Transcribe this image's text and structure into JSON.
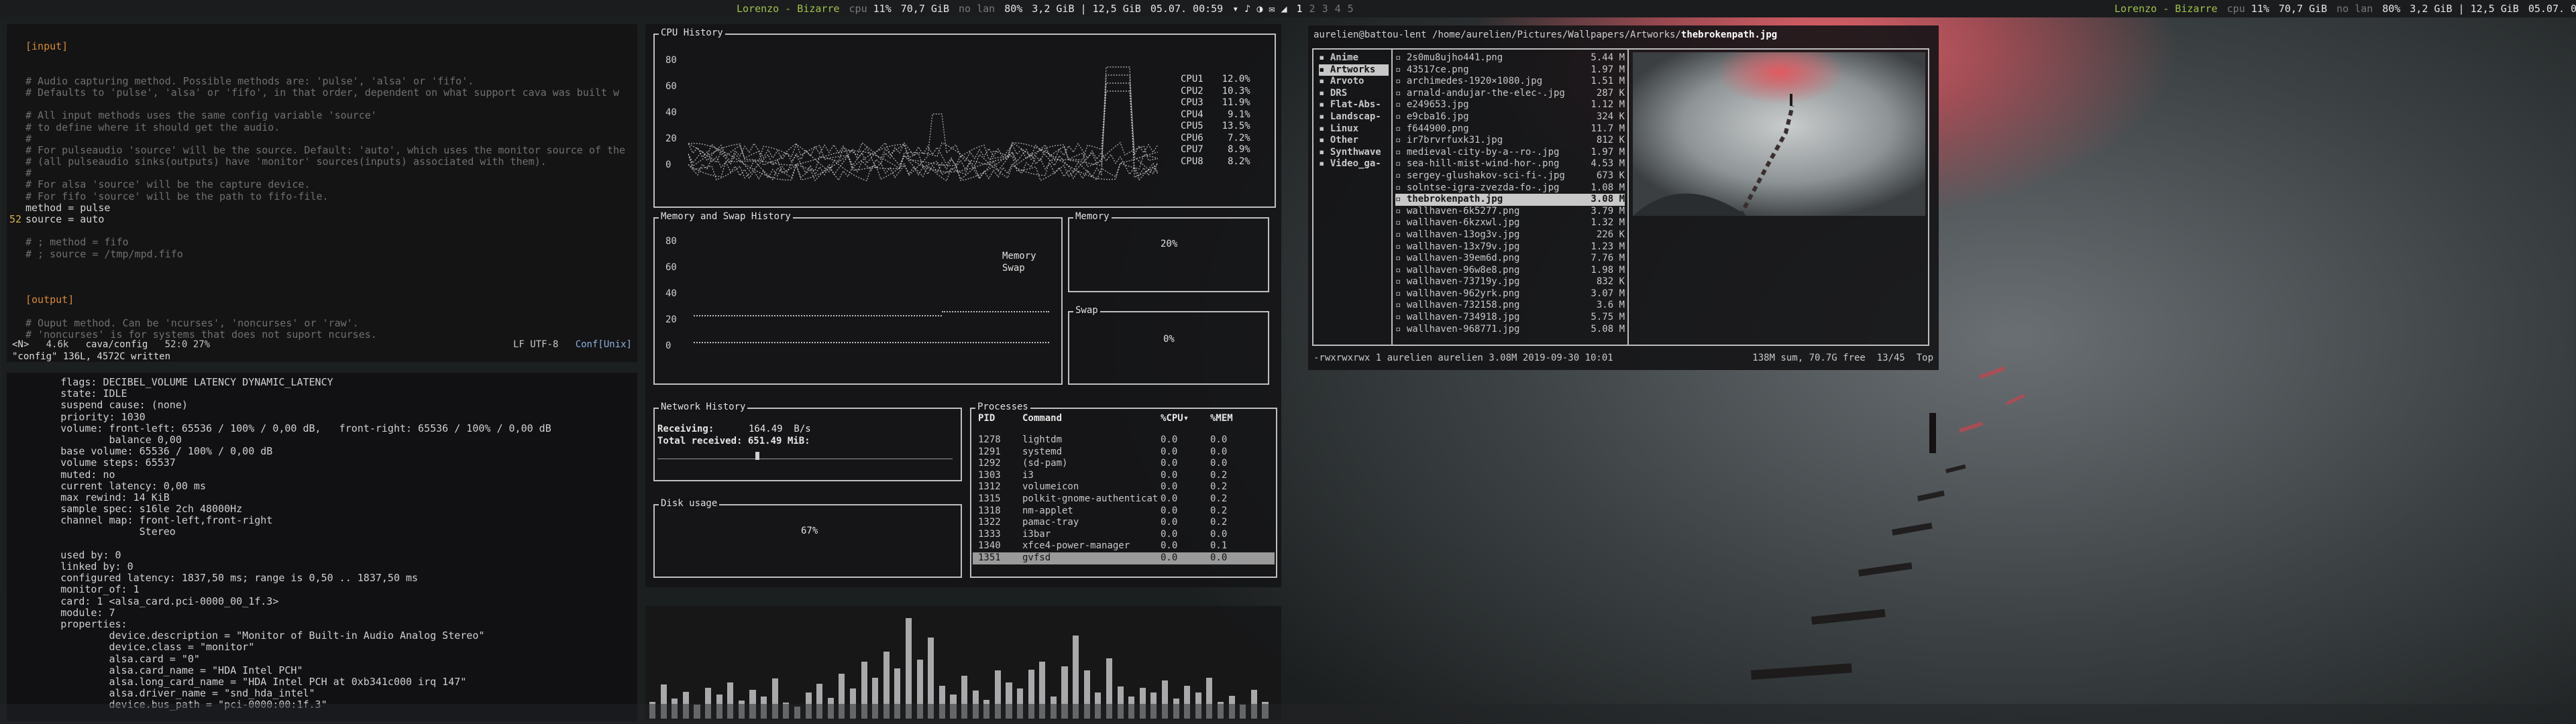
{
  "topbar": {
    "left": {
      "spotify": "Lorenzo - Bizarre",
      "cpu_label": "cpu",
      "cpu_value": "11%",
      "disk": "70,7 GiB",
      "lan": "no lan",
      "battery": "80%",
      "ram": "3,2 GiB | 12,5 GiB",
      "clock": "05.07. 00:59",
      "workspaces": [
        "1",
        "2",
        "3",
        "4",
        "5"
      ]
    },
    "right": {
      "spotify": "Lorenzo - Bizarre",
      "cpu_label": "cpu",
      "cpu_value": "11%",
      "disk": "70,7 GiB",
      "lan": "no lan",
      "battery": "80%",
      "ram": "3,2 GiB | 12,5 GiB",
      "clock": "05.07. 00:59"
    }
  },
  "editor": {
    "lines": [
      {
        "n": "",
        "t": "",
        "c": ""
      },
      {
        "n": "",
        "t": "[input]",
        "c": "sec"
      },
      {
        "n": "",
        "t": "",
        "c": ""
      },
      {
        "n": "",
        "t": "",
        "c": ""
      },
      {
        "n": "",
        "t": "# Audio capturing method. Possible methods are: 'pulse', 'alsa' or 'fifo'.",
        "c": "cm"
      },
      {
        "n": "",
        "t": "# Defaults to 'pulse', 'alsa' or 'fifo', in that order, dependent on what support cava was built w",
        "c": "cm"
      },
      {
        "n": "",
        "t": "",
        "c": ""
      },
      {
        "n": "",
        "t": "# All input methods uses the same config variable 'source'",
        "c": "cm"
      },
      {
        "n": "",
        "t": "# to define where it should get the audio.",
        "c": "cm"
      },
      {
        "n": "",
        "t": "#",
        "c": "cm"
      },
      {
        "n": "",
        "t": "# For pulseaudio 'source' will be the source. Default: 'auto', which uses the monitor source of the",
        "c": "cm"
      },
      {
        "n": "",
        "t": "# (all pulseaudio sinks(outputs) have 'monitor' sources(inputs) associated with them).",
        "c": "cm"
      },
      {
        "n": "",
        "t": "#",
        "c": "cm"
      },
      {
        "n": "",
        "t": "# For alsa 'source' will be the capture device.",
        "c": "cm"
      },
      {
        "n": "",
        "t": "# For fifo 'source' will be the path to fifo-file.",
        "c": "cm"
      },
      {
        "n": "",
        "t": "method = pulse",
        "c": "kw"
      },
      {
        "n": "52",
        "t": "source = auto",
        "c": "kw"
      },
      {
        "n": "",
        "t": "",
        "c": ""
      },
      {
        "n": "",
        "t": "# ; method = fifo",
        "c": "cm"
      },
      {
        "n": "",
        "t": "# ; source = /tmp/mpd.fifo",
        "c": "cm"
      },
      {
        "n": "",
        "t": "",
        "c": ""
      },
      {
        "n": "",
        "t": "",
        "c": ""
      },
      {
        "n": "",
        "t": "",
        "c": ""
      },
      {
        "n": "",
        "t": "[output]",
        "c": "sec"
      },
      {
        "n": "",
        "t": "",
        "c": ""
      },
      {
        "n": "",
        "t": "# Ouput method. Can be 'ncurses', 'noncurses' or 'raw'.",
        "c": "cm"
      },
      {
        "n": "",
        "t": "# 'noncurses' is for systems that does not suport ncurses.",
        "c": "cm"
      }
    ],
    "status_mode": "<N>",
    "status_size": "4.6k",
    "status_file": "cava/config",
    "status_pos": "52:0 27%",
    "status_enc": "LF UTF-8",
    "status_ft": "Conf[Unix]",
    "message": "\"config\" 136L, 4572C written"
  },
  "pactl": {
    "lines": [
      "        flags: DECIBEL_VOLUME LATENCY DYNAMIC_LATENCY",
      "        state: IDLE",
      "        suspend cause: (none)",
      "        priority: 1030",
      "        volume: front-left: 65536 / 100% / 0,00 dB,   front-right: 65536 / 100% / 0,00 dB",
      "                balance 0,00",
      "        base volume: 65536 / 100% / 0,00 dB",
      "        volume steps: 65537",
      "        muted: no",
      "        current latency: 0,00 ms",
      "        max rewind: 14 KiB",
      "        sample spec: s16le 2ch 48000Hz",
      "        channel map: front-left,front-right",
      "                     Stereo",
      "",
      "        used by: 0",
      "        linked by: 0",
      "        configured latency: 1837,50 ms; range is 0,50 .. 1837,50 ms",
      "        monitor_of: 1",
      "        card: 1 <alsa_card.pci-0000_00_1f.3>",
      "        module: 7",
      "        properties:",
      "                device.description = \"Monitor of Built-in Audio Analog Stereo\"",
      "                device.class = \"monitor\"",
      "                alsa.card = \"0\"",
      "                alsa.card_name = \"HDA Intel PCH\"",
      "                alsa.long_card_name = \"HDA Intel PCH at 0xb341c000 irq 147\"",
      "                alsa.driver_name = \"snd_hda_intel\"",
      "                device.bus_path = \"pci-0000:00:1f.3\""
    ]
  },
  "gtop": {
    "cpu_title": "CPU History",
    "cpu_ticks": [
      "80",
      "60",
      "40",
      "20",
      "0"
    ],
    "cpu_legend": [
      {
        "name": "CPU1",
        "value": "12.0%",
        "color": "#e06060"
      },
      {
        "name": "CPU2",
        "value": "10.3%",
        "color": "#60c060"
      },
      {
        "name": "CPU3",
        "value": "11.9%",
        "color": "#d0c060"
      },
      {
        "name": "CPU4",
        "value": "9.1%",
        "color": "#6090e0"
      },
      {
        "name": "CPU5",
        "value": "13.5%",
        "color": "#c060c0"
      },
      {
        "name": "CPU6",
        "value": "7.2%",
        "color": "#60c0c0"
      },
      {
        "name": "CPU7",
        "value": "8.9%",
        "color": "#e0e0e0"
      },
      {
        "name": "CPU8",
        "value": "8.2%",
        "color": "#e09060"
      }
    ],
    "mem_title": "Memory and Swap History",
    "mem_ticks": [
      "80",
      "60",
      "40",
      "20",
      "0"
    ],
    "mem_legend": [
      "Memory",
      "Swap"
    ],
    "memory_title": "Memory",
    "memory_value": "20%",
    "swap_title": "Swap",
    "swap_value": "0%",
    "net_title": "Network History",
    "net_receiving_label": "Receiving:",
    "net_receiving_value": "164.49  B/s",
    "net_total_label": "Total received: 651.49 MiB:",
    "disk_title": "Disk usage",
    "disk_value": "67%",
    "proc_title": "Processes",
    "proc_headers": [
      "PID",
      "Command",
      "%CPU▾",
      "%MEM"
    ],
    "processes": [
      {
        "pid": "1278",
        "cmd": "lightdm",
        "cpu": "0.0",
        "mem": "0.0"
      },
      {
        "pid": "1291",
        "cmd": "systemd",
        "cpu": "0.0",
        "mem": "0.0"
      },
      {
        "pid": "1292",
        "cmd": "(sd-pam)",
        "cpu": "0.0",
        "mem": "0.0"
      },
      {
        "pid": "1303",
        "cmd": "i3",
        "cpu": "0.0",
        "mem": "0.2"
      },
      {
        "pid": "1312",
        "cmd": "volumeicon",
        "cpu": "0.0",
        "mem": "0.2"
      },
      {
        "pid": "1315",
        "cmd": "polkit-gnome-authenticat",
        "cpu": "0.0",
        "mem": "0.2"
      },
      {
        "pid": "1318",
        "cmd": "nm-applet",
        "cpu": "0.0",
        "mem": "0.2"
      },
      {
        "pid": "1322",
        "cmd": "pamac-tray",
        "cpu": "0.0",
        "mem": "0.2"
      },
      {
        "pid": "1333",
        "cmd": "i3bar",
        "cpu": "0.0",
        "mem": "0.0"
      },
      {
        "pid": "1340",
        "cmd": "xfce4-power-manager",
        "cpu": "0.0",
        "mem": "0.1"
      },
      {
        "pid": "1351",
        "cmd": "gvfsd",
        "cpu": "0.0",
        "mem": "0.0"
      }
    ],
    "proc_selected_index": 10
  },
  "cava": {
    "bars": [
      0.17,
      0.34,
      0.2,
      0.27,
      0.14,
      0.31,
      0.24,
      0.36,
      0.18,
      0.29,
      0.22,
      0.4,
      0.16,
      0.12,
      0.26,
      0.35,
      0.21,
      0.45,
      0.3,
      0.57,
      0.41,
      0.67,
      0.5,
      1.0,
      0.59,
      0.81,
      0.33,
      0.24,
      0.43,
      0.28,
      0.19,
      0.48,
      0.36,
      0.3,
      0.49,
      0.57,
      0.22,
      0.52,
      0.83,
      0.48,
      0.26,
      0.6,
      0.32,
      0.22,
      0.31,
      0.26,
      0.38,
      0.2,
      0.33,
      0.26,
      0.41,
      0.17,
      0.23,
      0.14,
      0.29,
      0.17
    ]
  },
  "ranger": {
    "title_user": "aurelien@battou-lent",
    "title_path": "/home/aurelien/Pictures/Wallpapers/Artworks/",
    "title_file": "thebrokenpath.jpg",
    "dirs": [
      "Anime",
      "Artworks",
      "Arvoto",
      "DRS",
      "Flat-Abs-",
      "Landscap-",
      "Linux",
      "Other",
      "Synthwave",
      "Video_ga-"
    ],
    "selected_dir": 1,
    "files": [
      {
        "name": "2s0mu8ujho441.png",
        "size": "5.44 M"
      },
      {
        "name": "43517ce.png",
        "size": "1.97 M"
      },
      {
        "name": "archimedes-1920×1080.jpg",
        "size": "1.51 M"
      },
      {
        "name": "arnald-andujar-the-elec-.jpg",
        "size": "287 K"
      },
      {
        "name": "e249653.jpg",
        "size": "1.12 M"
      },
      {
        "name": "e9cba16.jpg",
        "size": "324 K"
      },
      {
        "name": "f644900.png",
        "size": "11.7 M"
      },
      {
        "name": "ir7brvrfuxk31.jpg",
        "size": "812 K"
      },
      {
        "name": "medieval-city-by-a--ro-.jpg",
        "size": "1.97 M"
      },
      {
        "name": "sea-hill-mist-wind-hor-.png",
        "size": "4.53 M"
      },
      {
        "name": "sergey-glushakov-sci-fi-.jpg",
        "size": "673 K"
      },
      {
        "name": "solntse-igra-zvezda-fo-.jpg",
        "size": "1.08 M"
      },
      {
        "name": "thebrokenpath.jpg",
        "size": "3.08 M"
      },
      {
        "name": "wallhaven-6k5277.png",
        "size": "3.79 M"
      },
      {
        "name": "wallhaven-6kzxwl.jpg",
        "size": "1.32 M"
      },
      {
        "name": "wallhaven-13og3v.jpg",
        "size": "226 K"
      },
      {
        "name": "wallhaven-13x79v.jpg",
        "size": "1.23 M"
      },
      {
        "name": "wallhaven-39em6d.png",
        "size": "7.76 M"
      },
      {
        "name": "wallhaven-96w8e8.png",
        "size": "1.98 M"
      },
      {
        "name": "wallhaven-73719y.jpg",
        "size": "832 K"
      },
      {
        "name": "wallhaven-962yrk.png",
        "size": "3.07 M"
      },
      {
        "name": "wallhaven-732158.png",
        "size": "3.6 M"
      },
      {
        "name": "wallhaven-734918.jpg",
        "size": "5.75 M"
      },
      {
        "name": "wallhaven-968771.jpg",
        "size": "5.08 M"
      }
    ],
    "selected_file": 12,
    "status_left": "-rwxrwxrwx 1 aurelien aurelien 3.08M 2019-09-30 10:01",
    "status_right": "138M sum, 70.7G free  13/45  Top"
  }
}
